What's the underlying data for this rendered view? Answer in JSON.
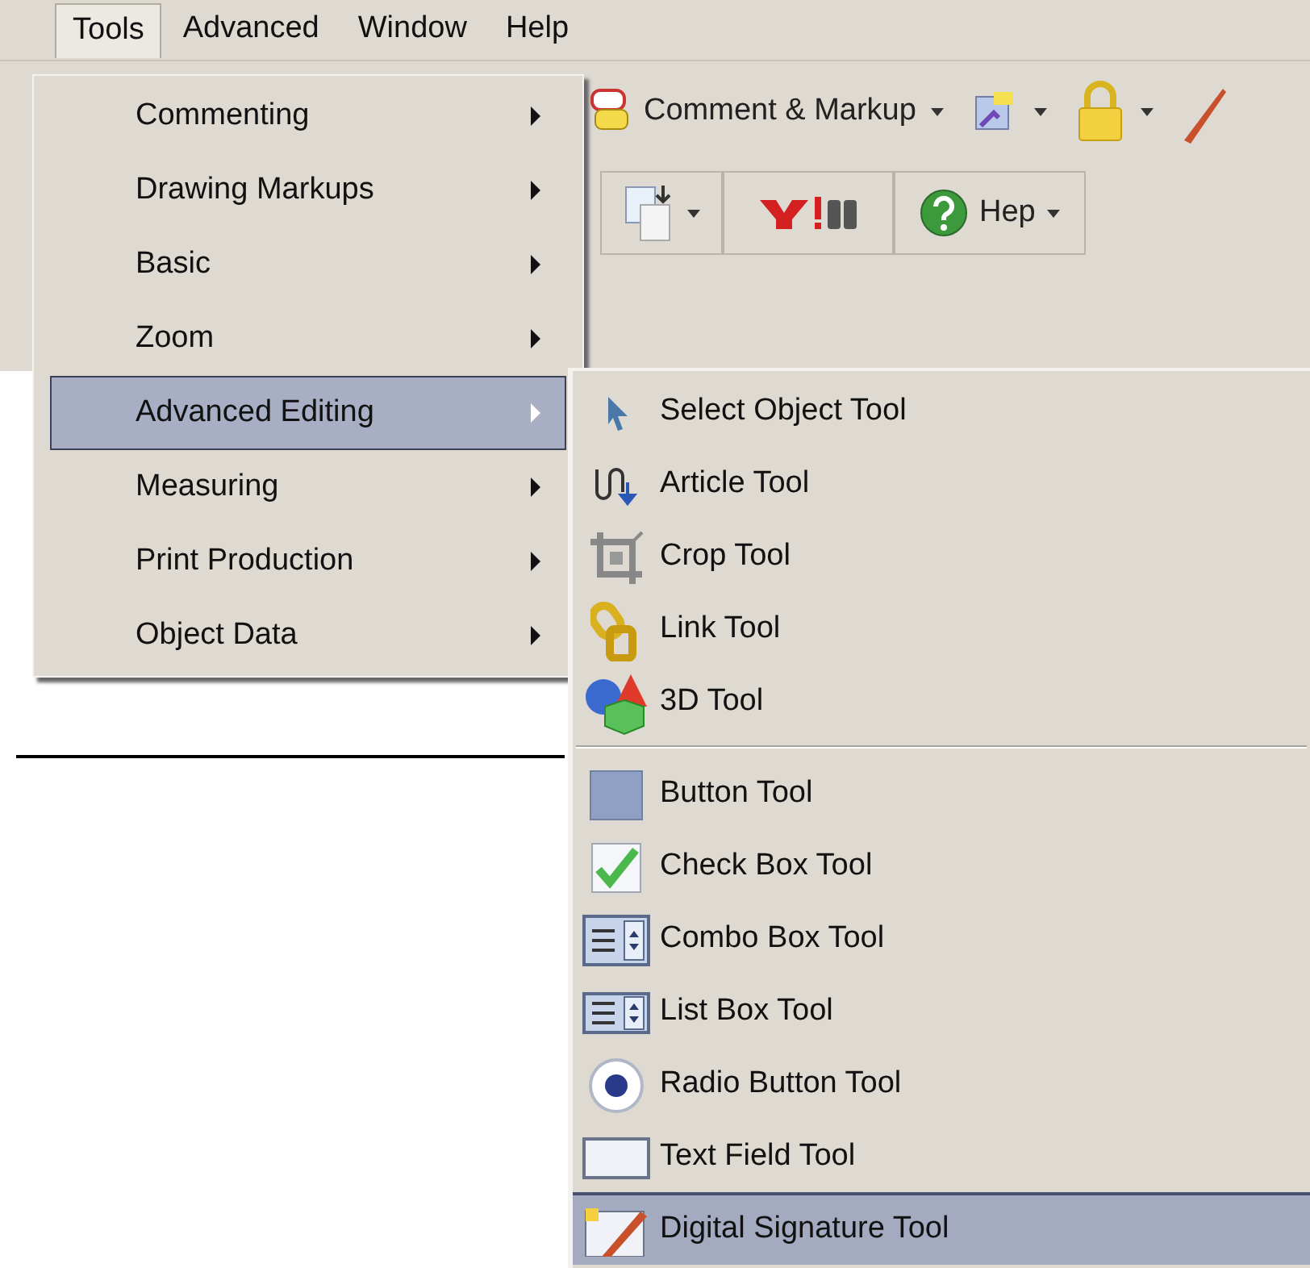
{
  "menubar": [
    {
      "label": "Tools",
      "selected": true
    },
    {
      "label": "Advanced",
      "selected": false
    },
    {
      "label": "Window",
      "selected": false
    },
    {
      "label": "Help",
      "selected": false
    }
  ],
  "toolbar": {
    "comment_button": "Comment & Markup",
    "help_button": "Hep"
  },
  "tools_menu": [
    {
      "label": "Commenting",
      "selected": false
    },
    {
      "label": "Drawing Markups",
      "selected": false
    },
    {
      "label": "Basic",
      "selected": false
    },
    {
      "label": "Zoom",
      "selected": false
    },
    {
      "label": "Advanced Editing",
      "selected": true
    },
    {
      "label": "Measuring",
      "selected": false
    },
    {
      "label": "Print Production",
      "selected": false
    },
    {
      "label": "Object Data",
      "selected": false
    }
  ],
  "submenu": {
    "groups": [
      [
        {
          "kind": "select",
          "label": "Select Object Tool",
          "selected": false
        },
        {
          "kind": "article",
          "label": "Article Tool",
          "selected": false
        },
        {
          "kind": "crop",
          "label": "Crop Tool",
          "selected": false
        },
        {
          "kind": "link",
          "label": "Link Tool",
          "selected": false
        },
        {
          "kind": "solid",
          "label": "3D Tool",
          "selected": false
        }
      ],
      [
        {
          "kind": "button",
          "label": "Button Tool",
          "selected": false
        },
        {
          "kind": "checkbox",
          "label": "Check Box Tool",
          "selected": false
        },
        {
          "kind": "combo",
          "label": "Combo Box Tool",
          "selected": false
        },
        {
          "kind": "listbox",
          "label": "List Box Tool",
          "selected": false
        },
        {
          "kind": "radio",
          "label": "Radio Button Tool",
          "selected": false
        },
        {
          "kind": "textfield",
          "label": "Text Field Tool",
          "selected": false
        },
        {
          "kind": "signature",
          "label": "Digital Signature Tool",
          "selected": true
        }
      ]
    ]
  }
}
